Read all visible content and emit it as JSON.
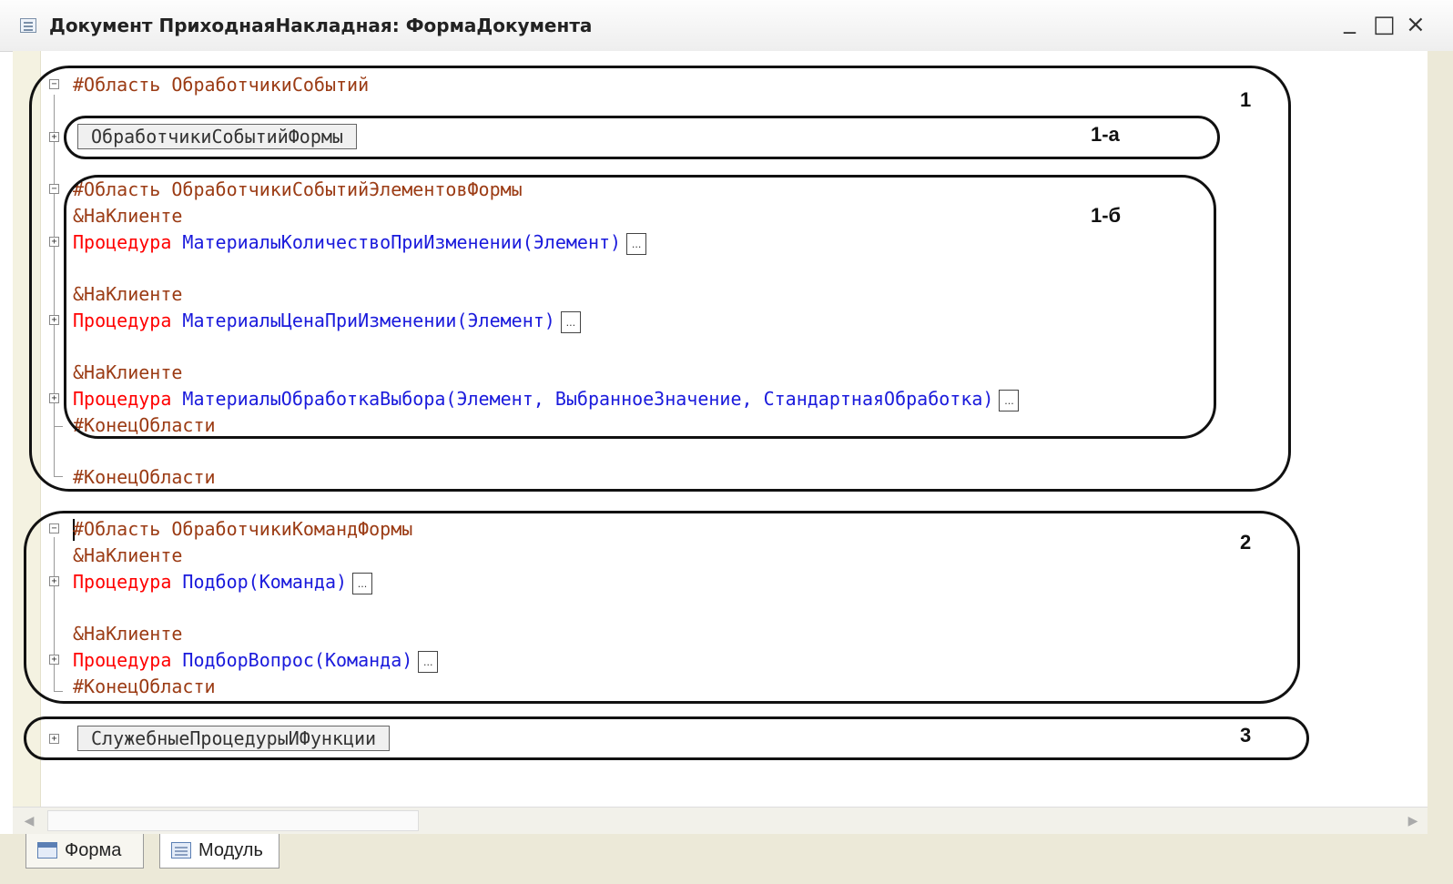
{
  "window": {
    "title": "Документ ПриходнаяНакладная: ФормаДокумента",
    "minimize_glyph": "_",
    "maximize_glyph": "□",
    "close_glyph": "×"
  },
  "code": {
    "region1_open_kw": "#Область",
    "region1_name": "ОбработчикиСобытий",
    "collapsed_1a": "ОбработчикиСобытийФормы",
    "region1b_open_kw": "#Область",
    "region1b_name": "ОбработчикиСобытийЭлементовФормы",
    "directive": "&НаКлиенте",
    "proc_kw": "Процедура",
    "proc1_name": "МатериалыКоличествоПриИзменении",
    "proc1_params": "(Элемент)",
    "proc2_name": "МатериалыЦенаПриИзменении",
    "proc2_params": "(Элемент)",
    "proc3_name": "МатериалыОбработкаВыбора",
    "proc3_params": "(Элемент, ВыбранноеЗначение, СтандартнаяОбработка)",
    "end_region": "#КонецОбласти",
    "region2_open_kw": "#Область",
    "region2_name": "ОбработчикиКомандФормы",
    "proc4_name": "Подбор",
    "proc4_params": "(Команда)",
    "proc5_name": "ПодборВопрос",
    "proc5_params": "(Команда)",
    "collapsed_3": "СлужебныеПроцедурыИФункции",
    "ellipsis": "..."
  },
  "annotations": {
    "label_1": "1",
    "label_1a": "1-а",
    "label_1b": "1-б",
    "label_2": "2",
    "label_3": "3"
  },
  "tabs": [
    {
      "label": "Форма",
      "icon": "form-icon",
      "active": false
    },
    {
      "label": "Модуль",
      "icon": "module-icon",
      "active": true
    }
  ],
  "colors": {
    "region_keyword": "#9b3b14",
    "procedure_keyword": "#ff0000",
    "identifier": "#1a1adc"
  }
}
